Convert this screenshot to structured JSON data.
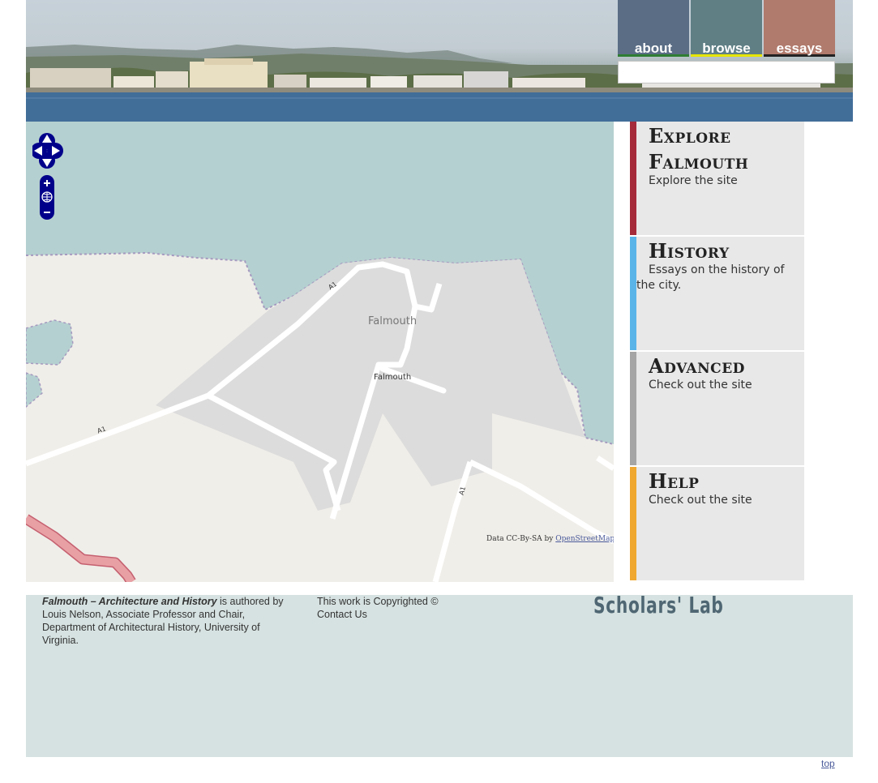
{
  "nav": {
    "tabs": [
      {
        "label": "about",
        "color": "#5a6d85",
        "underline": "#2e7d32"
      },
      {
        "label": "browse",
        "color": "#5f7f85",
        "underline": "#e6e600"
      },
      {
        "label": "essays",
        "color": "#b07a6c",
        "underline": "#222222"
      }
    ],
    "search_value": ""
  },
  "map": {
    "town_label": "Falmouth",
    "street_label": "Falmouth",
    "road_labels": [
      "A1",
      "A1",
      "A1"
    ],
    "attribution_prefix": "Data CC-By-SA by",
    "attribution_link": "OpenStreetMap",
    "controls": [
      "pan-up-icon",
      "pan-left-icon",
      "pan-right-icon",
      "pan-down-icon",
      "zoom-in-icon",
      "zoom-world-icon",
      "zoom-out-icon"
    ]
  },
  "panels": [
    {
      "title": "Explore Falmouth",
      "description": "Explore the site",
      "color": "#a52a3a"
    },
    {
      "title": "History",
      "description": "Essays on the history of the city.",
      "color": "#5ab4e8"
    },
    {
      "title": "Advanced",
      "description": "Check out the site",
      "color": "#a5a5a5"
    },
    {
      "title": "Help",
      "description": "Check out the site",
      "color": "#f0a830"
    }
  ],
  "footer": {
    "credit_title": "Falmouth – Architecture and History",
    "credit_rest": " is authored by Louis Nelson, Associate Professor and Chair, Department of Architectural History, University of Virginia.",
    "copyright": "This work is Copyrighted ©",
    "contact": "Contact Us",
    "logo": "Scholars' Lab"
  },
  "top_link": "top"
}
